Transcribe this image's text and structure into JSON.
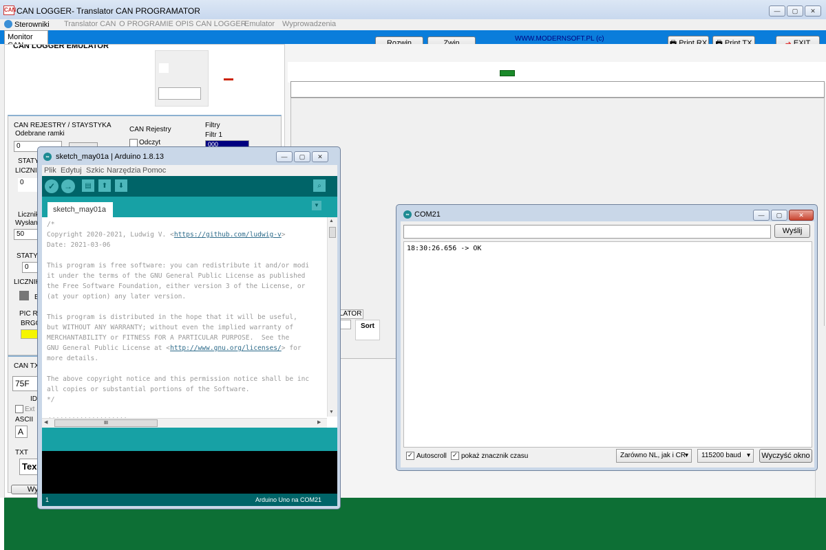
{
  "app": {
    "title": "CAN LOGGER- Translator CAN PROGRAMATOR",
    "logo": "CAN",
    "menu": [
      "Sterowniki",
      "Translator CAN",
      "O PROGRAMIE",
      "OPIS CAN LOGGER",
      "Emulator",
      "Wyprowadzenia"
    ],
    "tab": "Monitor CAN",
    "buttons": {
      "rozwin": "Rozwin",
      "zwin": "Zwin",
      "print_rx": "Print RX",
      "print_tx": "Print TX",
      "exit": "EXIT"
    },
    "website": "WWW.MODERNSOFT.PL  (c)",
    "colors": {
      "title_bar": "#c8d8ee",
      "band": "#0a7ddb",
      "bottom": "#0d6f35",
      "accent_red": "#cc2200",
      "indicator_green": "#1a8a2a"
    }
  },
  "left_panel": {
    "header": "CAN LOGGER EMULATOR",
    "registers_title": "CAN REJESTRY / STAYSTYKA",
    "received_frames": "Odebrane ramki",
    "received_value": "0",
    "can_rejestry": "CAN Rejestry",
    "odczyt": "Odczyt",
    "filtry": "Filtry",
    "filtr1": "Filtr 1",
    "filtr1_value": "000",
    "statys": "STATYS",
    "licznik": "LICZNIK",
    "licznik_value": "0",
    "licznik_t": "Licznik T",
    "wyslane": "Wysłane",
    "wyslane_value": "50",
    "statys2": "STATYS",
    "statys2_value": "0",
    "licznik2": "LICZNIK",
    "b": "B",
    "pic_re": "PIC RE",
    "brgc": "BRGCO",
    "can_tx": "CAN TX",
    "id_value": "75F",
    "id_label": "ID",
    "ext": "Ext",
    "ascii": "ASCII",
    "ascii_a": "A",
    "txt": "TXT",
    "txt_value": "Tex",
    "send_btn": "Wys"
  },
  "right_area": {
    "lator": "LATOR",
    "sort": "Sort"
  },
  "arduino": {
    "title": "sketch_may01a | Arduino 1.8.13",
    "menu": [
      "Plik",
      "Edytuj",
      "Szkic",
      "Narzędzia",
      "Pomoc"
    ],
    "tab": "sketch_may01a",
    "code": {
      "l1": "/*",
      "l2a": "Copyright 2020-2021, Ludwig V. <",
      "l2u": "https://github.com/ludwig-v",
      "l2b": ">",
      "l3": "Date: 2021-03-06",
      "l4": "",
      "l5": "This program is free software: you can redistribute it and/or modi",
      "l6": "it under the terms of the GNU General Public License as published",
      "l7": "the Free Software Foundation, either version 3 of the License, or",
      "l8": "(at your option) any later version.",
      "l9": "",
      "l10": "This program is distributed in the hope that it will be useful,",
      "l11": "but WITHOUT ANY WARRANTY; without even the implied warranty of",
      "l12": "MERCHANTABILITY or FITNESS FOR A PARTICULAR PURPOSE.  See the",
      "l13a": "GNU General Public License at <",
      "l13u": "http://www.gnu.org/licenses/",
      "l13b": "> for",
      "l14": "more details.",
      "l15": "",
      "l16": "The above copyright notice and this permission notice shall be inc",
      "l17": "all copies or substantial portions of the Software.",
      "l18": "*/",
      "l19": "",
      "l20": "////////////////////"
    },
    "scroll_thumb": "III",
    "line_no": "1",
    "board": "Arduino Uno na COM21"
  },
  "serial": {
    "title": "COM21",
    "send": "Wyślij",
    "output": "18:30:26.656 -> OK",
    "autoscroll": "Autoscroll",
    "timestamp": "pokaż znacznik czasu",
    "line_ending": "Zarówno NL, jak i CR",
    "baud": "115200 baud",
    "clear": "Wyczyść okno"
  }
}
